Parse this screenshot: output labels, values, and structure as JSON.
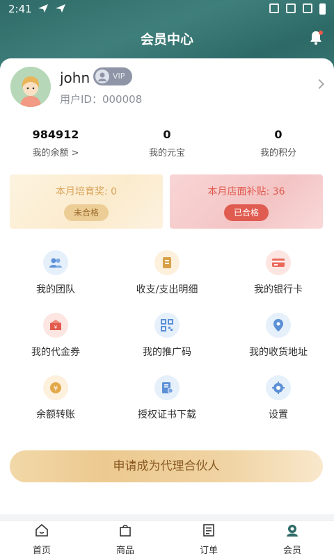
{
  "status_bar": {
    "time": "2:41"
  },
  "header": {
    "title": "会员中心",
    "bell_icon": "bell-icon"
  },
  "profile": {
    "username": "john",
    "vip_label": "VIP",
    "user_id": "用户ID：000008"
  },
  "stats": [
    {
      "value": "984912",
      "label": "我的余额 >"
    },
    {
      "value": "0",
      "label": "我的元宝"
    },
    {
      "value": "0",
      "label": "我的积分"
    }
  ],
  "banners": [
    {
      "title": "本月培育奖: 0",
      "button": "未合格"
    },
    {
      "title": "本月店面补贴: 36",
      "button": "已合格"
    }
  ],
  "menu": [
    {
      "label": "我的团队",
      "icon": "team-icon",
      "color": "#e6f0fb"
    },
    {
      "label": "收支/支出明细",
      "icon": "ledger-icon",
      "color": "#fdf0dc"
    },
    {
      "label": "我的银行卡",
      "icon": "bank-card-icon",
      "color": "#fde5e2"
    },
    {
      "label": "我的代金券",
      "icon": "voucher-icon",
      "color": "#fde5e2"
    },
    {
      "label": "我的推广码",
      "icon": "qrcode-icon",
      "color": "#e6f0fb"
    },
    {
      "label": "我的收货地址",
      "icon": "location-icon",
      "color": "#e6f0fb"
    },
    {
      "label": "余额转账",
      "icon": "transfer-icon",
      "color": "#fdf0dc"
    },
    {
      "label": "授权证书下载",
      "icon": "certificate-icon",
      "color": "#e6f0fb"
    },
    {
      "label": "设置",
      "icon": "settings-icon",
      "color": "#e6f0fb"
    }
  ],
  "apply_button": "申请成为代理合伙人",
  "tabs": [
    {
      "label": "首页",
      "icon": "home-icon"
    },
    {
      "label": "商品",
      "icon": "bag-icon"
    },
    {
      "label": "订单",
      "icon": "order-icon"
    },
    {
      "label": "会员",
      "icon": "member-icon"
    }
  ]
}
